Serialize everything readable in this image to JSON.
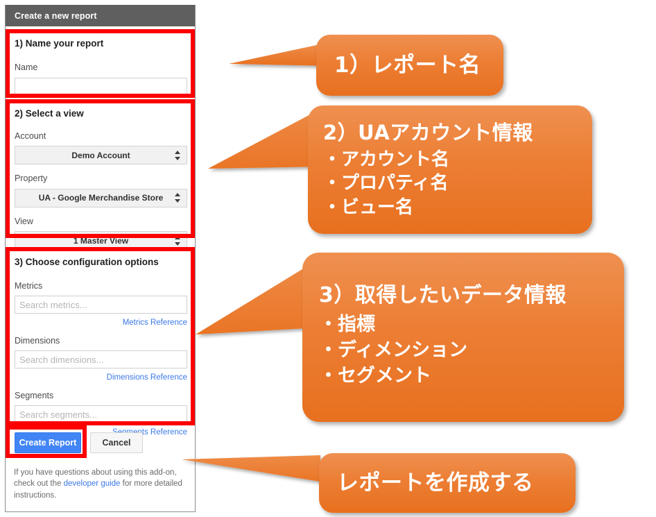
{
  "panel": {
    "header_title": "Create a new report",
    "sections": [
      {
        "heading": "1) Name your report",
        "fields": [
          {
            "label": "Name",
            "value": "",
            "placeholder": ""
          }
        ]
      },
      {
        "heading": "2) Select a view",
        "fields": [
          {
            "label": "Account",
            "value": "Demo Account"
          },
          {
            "label": "Property",
            "value": "UA - Google Merchandise Store"
          },
          {
            "label": "View",
            "value": "1 Master View"
          }
        ]
      },
      {
        "heading": "3) Choose configuration options",
        "fields": [
          {
            "label": "Metrics",
            "placeholder": "Search metrics...",
            "value": "",
            "ref": "Metrics Reference"
          },
          {
            "label": "Dimensions",
            "placeholder": "Search dimensions...",
            "value": "",
            "ref": "Dimensions Reference"
          },
          {
            "label": "Segments",
            "placeholder": "Search segments...",
            "value": "",
            "ref": "Segments Reference"
          }
        ]
      }
    ],
    "buttons": {
      "create": "Create Report",
      "cancel": "Cancel"
    },
    "footer": {
      "text_before": "If you have questions about using this add-on, check out the ",
      "link": "developer guide",
      "text_after": " for more detailed instructions."
    }
  },
  "annotations": {
    "highlight_color": "#fc0000",
    "callout_color_top": "#ef9050",
    "callout_color_bottom": "#e8701f",
    "callouts": [
      {
        "title": "1）レポート名",
        "items": []
      },
      {
        "title": "2）UAアカウント情報",
        "items": [
          "・アカウント名",
          "・プロパティ名",
          "・ビュー名"
        ]
      },
      {
        "title": "3）取得したいデータ情報",
        "items": [
          "・指標",
          "・ディメンション",
          "・セグメント"
        ]
      },
      {
        "title": "レポートを作成する",
        "items": []
      }
    ]
  }
}
